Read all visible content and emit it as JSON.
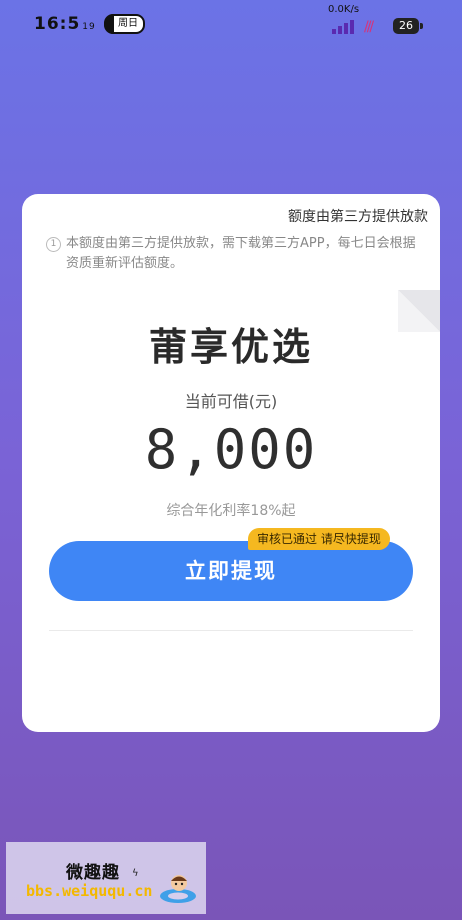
{
  "status_bar": {
    "time": "16:5",
    "time_suffix": "19",
    "holiday_label": "周日",
    "net_speed": "0.0K/s",
    "battery": "26"
  },
  "card": {
    "provider_note": "额度由第三方提供放款",
    "notice_icon": "1",
    "notice_text": "本额度由第三方提供放款，需下载第三方APP，每七日会根据资质重新评估额度。",
    "product_name": "莆享优选",
    "available_label": "当前可借(元)",
    "amount": "8,000",
    "rate_text": "综合年化利率18%起",
    "badge_text": "审核已通过 请尽快提现",
    "cta_label": "立即提现"
  },
  "watermark": {
    "title": "微趣趣",
    "url": "bbs.weiququ.cn"
  },
  "colors": {
    "cta": "#3f86f5",
    "badge": "#f5b820",
    "background_top": "#6b73e6",
    "background_bottom": "#7a55b8"
  }
}
